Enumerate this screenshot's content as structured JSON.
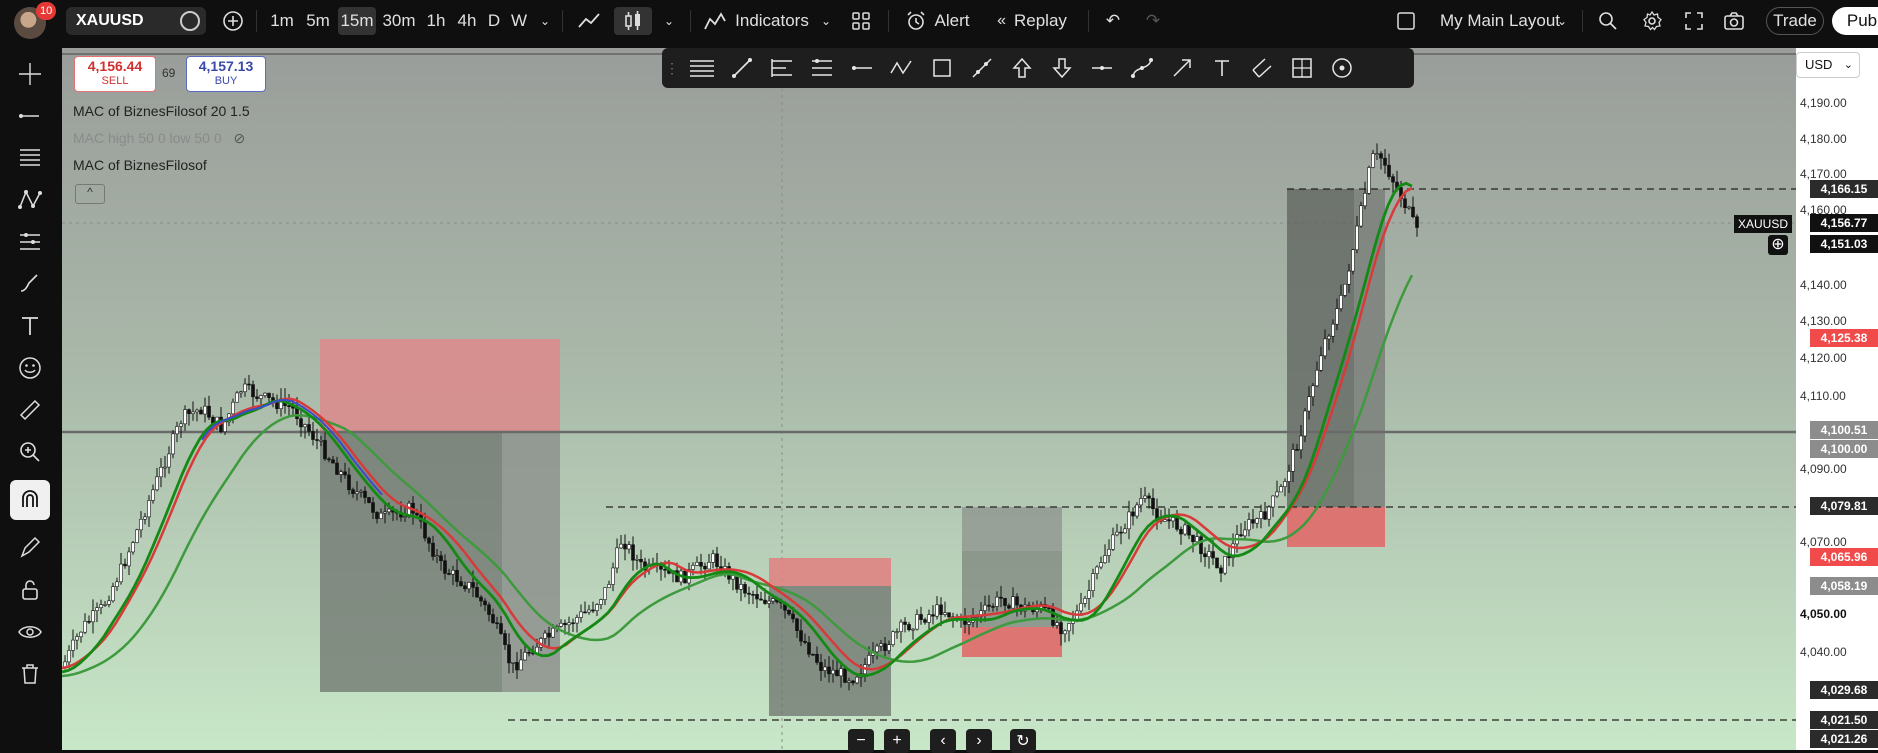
{
  "header": {
    "notifications": "10",
    "symbol": "XAUUSD",
    "timeframes": [
      "1m",
      "5m",
      "15m",
      "30m",
      "1h",
      "4h",
      "D",
      "W"
    ],
    "active_timeframe": "15m",
    "indicators_label": "Indicators",
    "alert_label": "Alert",
    "replay_label": "Replay",
    "layout_label": "My Main Layout",
    "trade_label": "Trade",
    "publish_label": "Pub"
  },
  "quote": {
    "sell_price": "4,156.44",
    "sell_label": "SELL",
    "spread": "69",
    "buy_price": "4,157.13",
    "buy_label": "BUY"
  },
  "legend": {
    "line1": "MAC of BiznesFilosof 20 1.5",
    "line2": "MAC high 50 0 low 50 0",
    "line3": "MAC of BiznesFilosof"
  },
  "currency": "USD",
  "price_axis": {
    "ticks": [
      "4,190.00",
      "4,180.00",
      "4,170.00",
      "4,160.00",
      "4,140.00",
      "4,130.00",
      "4,120.00",
      "4,110.00",
      "4,090.00",
      "4,070.00",
      "4,050.00",
      "4,040.00"
    ],
    "labels": {
      "p4166": "4,166.15",
      "p4156": "4,156.77",
      "p4151": "4,151.03",
      "p4125": "4,125.38",
      "p4100a": "4,100.51",
      "p4100b": "4,100.00",
      "p4079": "4,079.81",
      "p4065": "4,065.96",
      "p4058": "4,058.19",
      "p4029": "4,029.68",
      "p4021a": "4,021.50",
      "p4021b": "4,021.26"
    },
    "symbol_tag": "XAUUSD"
  },
  "colors": {
    "bg_top": "#9e9e9e",
    "bg_bottom": "#c6e6c6",
    "red_zone": "#e57373",
    "dark_zone": "#616161",
    "ma_red": "#e53935",
    "ma_green": "#2e7d32",
    "ma_blue": "#3949ab"
  }
}
